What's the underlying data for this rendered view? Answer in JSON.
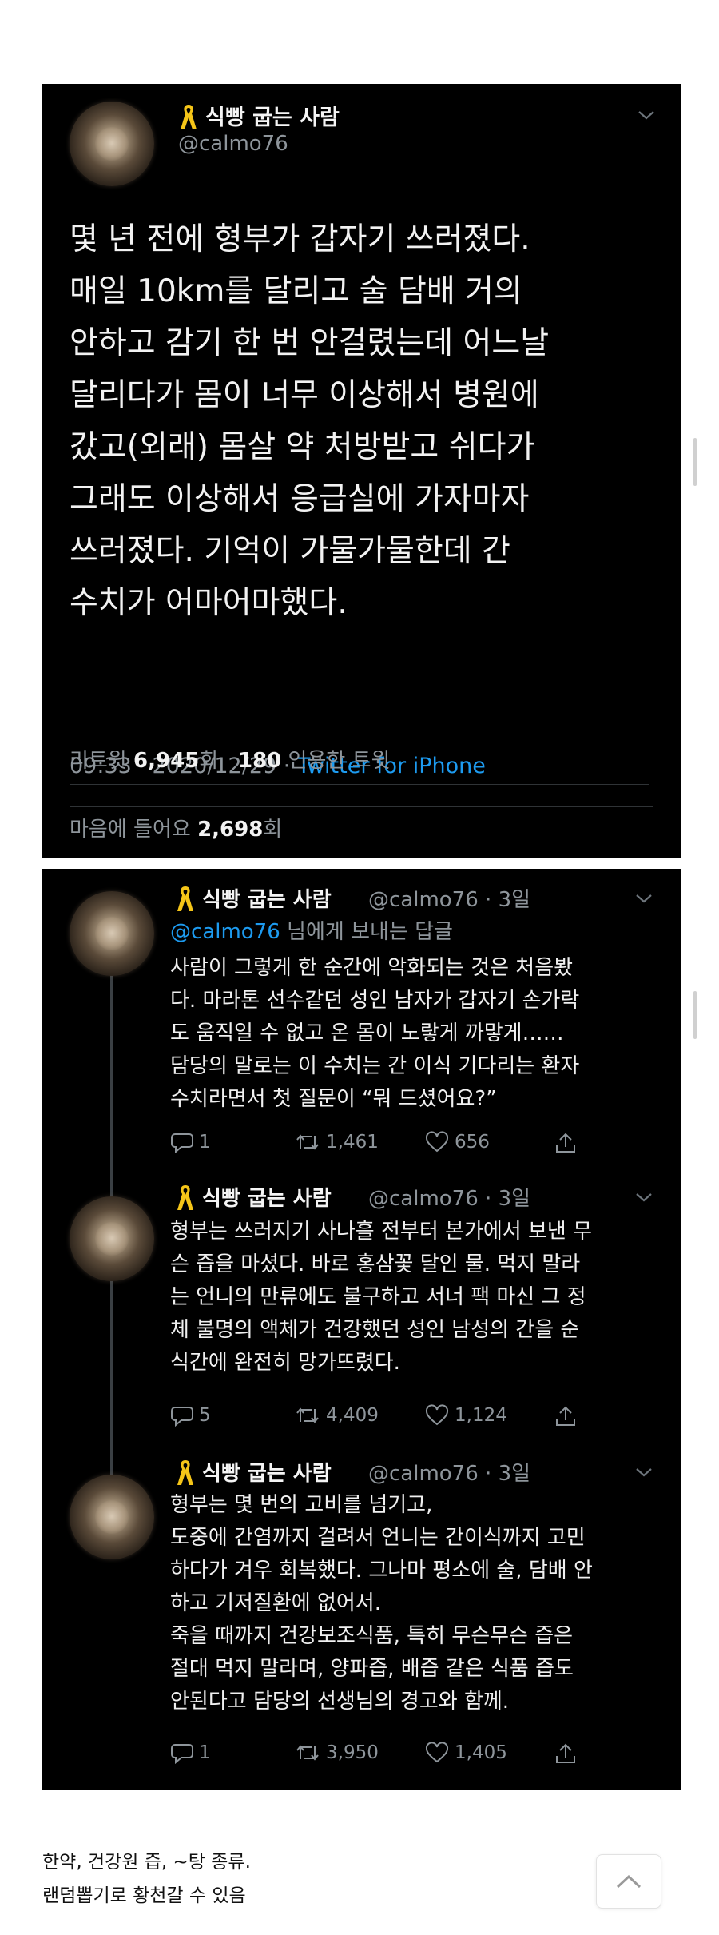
{
  "main_tweet": {
    "name": "식빵 굽는 사람",
    "handle": "@calmo76",
    "text": "몇 년 전에 형부가 갑자기 쓰러졌다.\n매일 10km를 달리고 술 담배 거의\n안하고 감기 한 번 안걸렸는데 어느날\n달리다가 몸이 너무 이상해서 병원에\n갔고(외래) 몸살 약 처방받고 쉬다가\n그래도 이상해서 응급실에 가자마자\n쓰러졌다. 기억이 가물가물한데 간\n수치가 어마어마했다.",
    "time": "09:33 · 2020/12/29 · ",
    "source": "Twitter for iPhone",
    "retweet_label": "리트윗 ",
    "retweet_count": "6,945",
    "retweet_unit": "회",
    "quote_count": "180",
    "quote_label": " 인용한 트윗",
    "like_label": "마음에 들어요 ",
    "like_count": "2,698",
    "like_unit": "회"
  },
  "replies": [
    {
      "name": "식빵 굽는 사람",
      "handle_time": "@calmo76 · 3일",
      "reply_mention": "@calmo76",
      "reply_suffix": " 님에게 보내는 답글",
      "text": "사람이 그렇게 한 순간에 악화되는 것은 처음봤\n다. 마라톤 선수같던 성인 남자가 갑자기 손가락\n도 움직일 수 없고 온 몸이 노랗게 까맣게……\n담당의 말로는 이 수치는 간 이식 기다리는 환자\n수치라면서 첫 질문이 “뭐 드셨어요?”",
      "comments": "1",
      "retweets": "1,461",
      "likes": "656"
    },
    {
      "name": "식빵 굽는 사람",
      "handle_time": "@calmo76 · 3일",
      "text": "형부는 쓰러지기 사나흘 전부터 본가에서 보낸 무\n슨 즙을 마셨다. 바로 홍삼꽃 달인 물. 먹지 말라\n는 언니의 만류에도 불구하고 서너 팩 마신 그 정\n체 불명의 액체가 건강했던 성인 남성의 간을 순\n식간에 완전히 망가뜨렸다.",
      "comments": "5",
      "retweets": "4,409",
      "likes": "1,124"
    },
    {
      "name": "식빵 굽는 사람",
      "handle_time": "@calmo76 · 3일",
      "text": "형부는 몇 번의 고비를 넘기고,\n도중에 간염까지 걸려서 언니는 간이식까지 고민\n하다가 겨우 회복했다. 그나마 평소에 술, 담배 안\n하고 기저질환에 없어서.\n죽을 때까지 건강보조식품, 특히 무슨무슨 즙은\n절대 먹지 말라며, 양파즙, 배즙 같은 식품 즙도\n안된다고 담당의 선생님의 경고와 함께.",
      "comments": "1",
      "retweets": "3,950",
      "likes": "1,405"
    }
  ],
  "caption": {
    "line1": "한약, 건강원 즙, ~탕 종류.",
    "line2": "랜덤뽑기로 황천갈 수 있음"
  },
  "colors": {
    "accent": "#1d9bf0",
    "ribbon": "#f5c518",
    "muted": "#8e959b"
  },
  "icons": [
    "yellow-ribbon-icon",
    "chevron-down-icon",
    "comment-icon",
    "retweet-icon",
    "heart-icon",
    "share-icon",
    "chevron-up-icon"
  ]
}
